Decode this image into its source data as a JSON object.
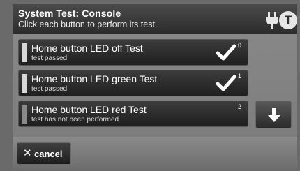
{
  "header": {
    "title": "System Test: Console",
    "subtitle": "Click each button to perform its test.",
    "t_badge": "T"
  },
  "icons": {
    "plug": "plug-icon",
    "badge": "t-icon",
    "check": "check-icon",
    "down": "arrow-down-icon",
    "cancel": "x-icon"
  },
  "tests": [
    {
      "name": "Home button LED off Test",
      "status": "test passed",
      "number": "0",
      "passed": true
    },
    {
      "name": "Home button LED green Test",
      "status": "test passed",
      "number": "1",
      "passed": true
    },
    {
      "name": "Home button LED red Test",
      "status": "test has not been performed",
      "number": "2",
      "passed": false
    }
  ],
  "footer": {
    "cancel_icon": "✕",
    "cancel_label": "cancel"
  },
  "colors": {
    "header_bg": "#2c2c2c",
    "row_bg": "#262626",
    "indicator_active": "#d8d8d8",
    "text": "#ffffff"
  }
}
